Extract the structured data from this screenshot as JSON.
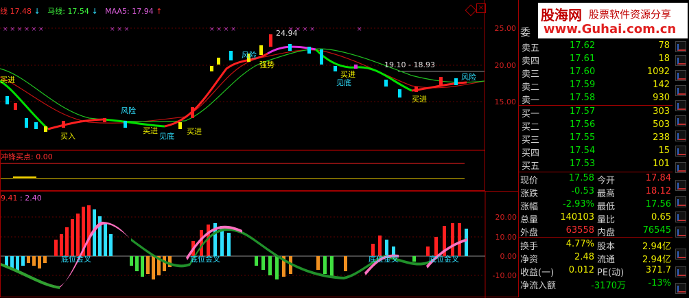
{
  "main_panel": {
    "ind1_label": "线",
    "ind1_value": "17.48",
    "ind2_label": "马线",
    "ind2_value": "17.54",
    "ind3_label": "MAA5",
    "ind3_value": "17.94",
    "arrows": [
      "↓",
      "↓",
      "↑"
    ],
    "y_ticks": [
      "25.00",
      "20.00",
      "15.00"
    ],
    "annotations": {
      "high": "24.94",
      "range": "19.10 - 18.93",
      "fengxian": "风险",
      "qiangshi": "强势",
      "maijin": "买进",
      "jiandi": "见底",
      "maichu": "买入"
    }
  },
  "mid_panel": {
    "title": "冲锋买点",
    "value": "0.00"
  },
  "low_panel": {
    "label1": "9.41",
    "label2": ": 2.40",
    "y_ticks": [
      "20.00",
      "10.00",
      "0.00",
      "-10.00"
    ],
    "signals": [
      "底位金叉",
      "底位金叉",
      "底位金叉",
      "底位金叉"
    ]
  },
  "brand": {
    "logo": "股海网",
    "slogan": "股票软件资源分享",
    "url": "www.Guhai.com.cn"
  },
  "quote": {
    "header": "委",
    "sell": [
      {
        "name": "卖五",
        "price": "17.62",
        "vol": "78"
      },
      {
        "name": "卖四",
        "price": "17.61",
        "vol": "18"
      },
      {
        "name": "卖三",
        "price": "17.60",
        "vol": "1092"
      },
      {
        "name": "卖二",
        "price": "17.59",
        "vol": "142"
      },
      {
        "name": "卖一",
        "price": "17.58",
        "vol": "930"
      }
    ],
    "buy": [
      {
        "name": "买一",
        "price": "17.57",
        "vol": "303"
      },
      {
        "name": "买二",
        "price": "17.56",
        "vol": "503"
      },
      {
        "name": "买三",
        "price": "17.55",
        "vol": "238"
      },
      {
        "name": "买四",
        "price": "17.54",
        "vol": "15"
      },
      {
        "name": "买五",
        "price": "17.53",
        "vol": "101"
      }
    ],
    "stats": [
      {
        "l1": "现价",
        "v1": "17.58",
        "l2": "今开",
        "v2": "17.84"
      },
      {
        "l1": "涨跌",
        "v1": "-0.53",
        "l2": "最高",
        "v2": "18.12"
      },
      {
        "l1": "涨幅",
        "v1": "-2.93%",
        "l2": "最低",
        "v2": "17.56"
      },
      {
        "l1": "总量",
        "v1": "140103",
        "l2": "量比",
        "v2": "0.65"
      },
      {
        "l1": "外盘",
        "v1": "63558",
        "l2": "内盘",
        "v2": "76545"
      },
      {
        "l1": "换手",
        "v1": "4.77%",
        "l2": "股本",
        "v2": "2.94亿"
      },
      {
        "l1": "净资",
        "v1": "2.48",
        "l2": "流通",
        "v2": "2.94亿"
      },
      {
        "l1": "收益(一)",
        "v1": "0.012",
        "l2": "PE(动)",
        "v2": "371.7"
      },
      {
        "l1": "净流入额",
        "v1": "-3170万",
        "l2": "",
        "v2": "-13%"
      }
    ]
  },
  "colors": {
    "up": "#ff2020",
    "down": "#00e000",
    "cyan": "#30e0ff",
    "yellow": "#f0f000",
    "border": "#a00000"
  }
}
